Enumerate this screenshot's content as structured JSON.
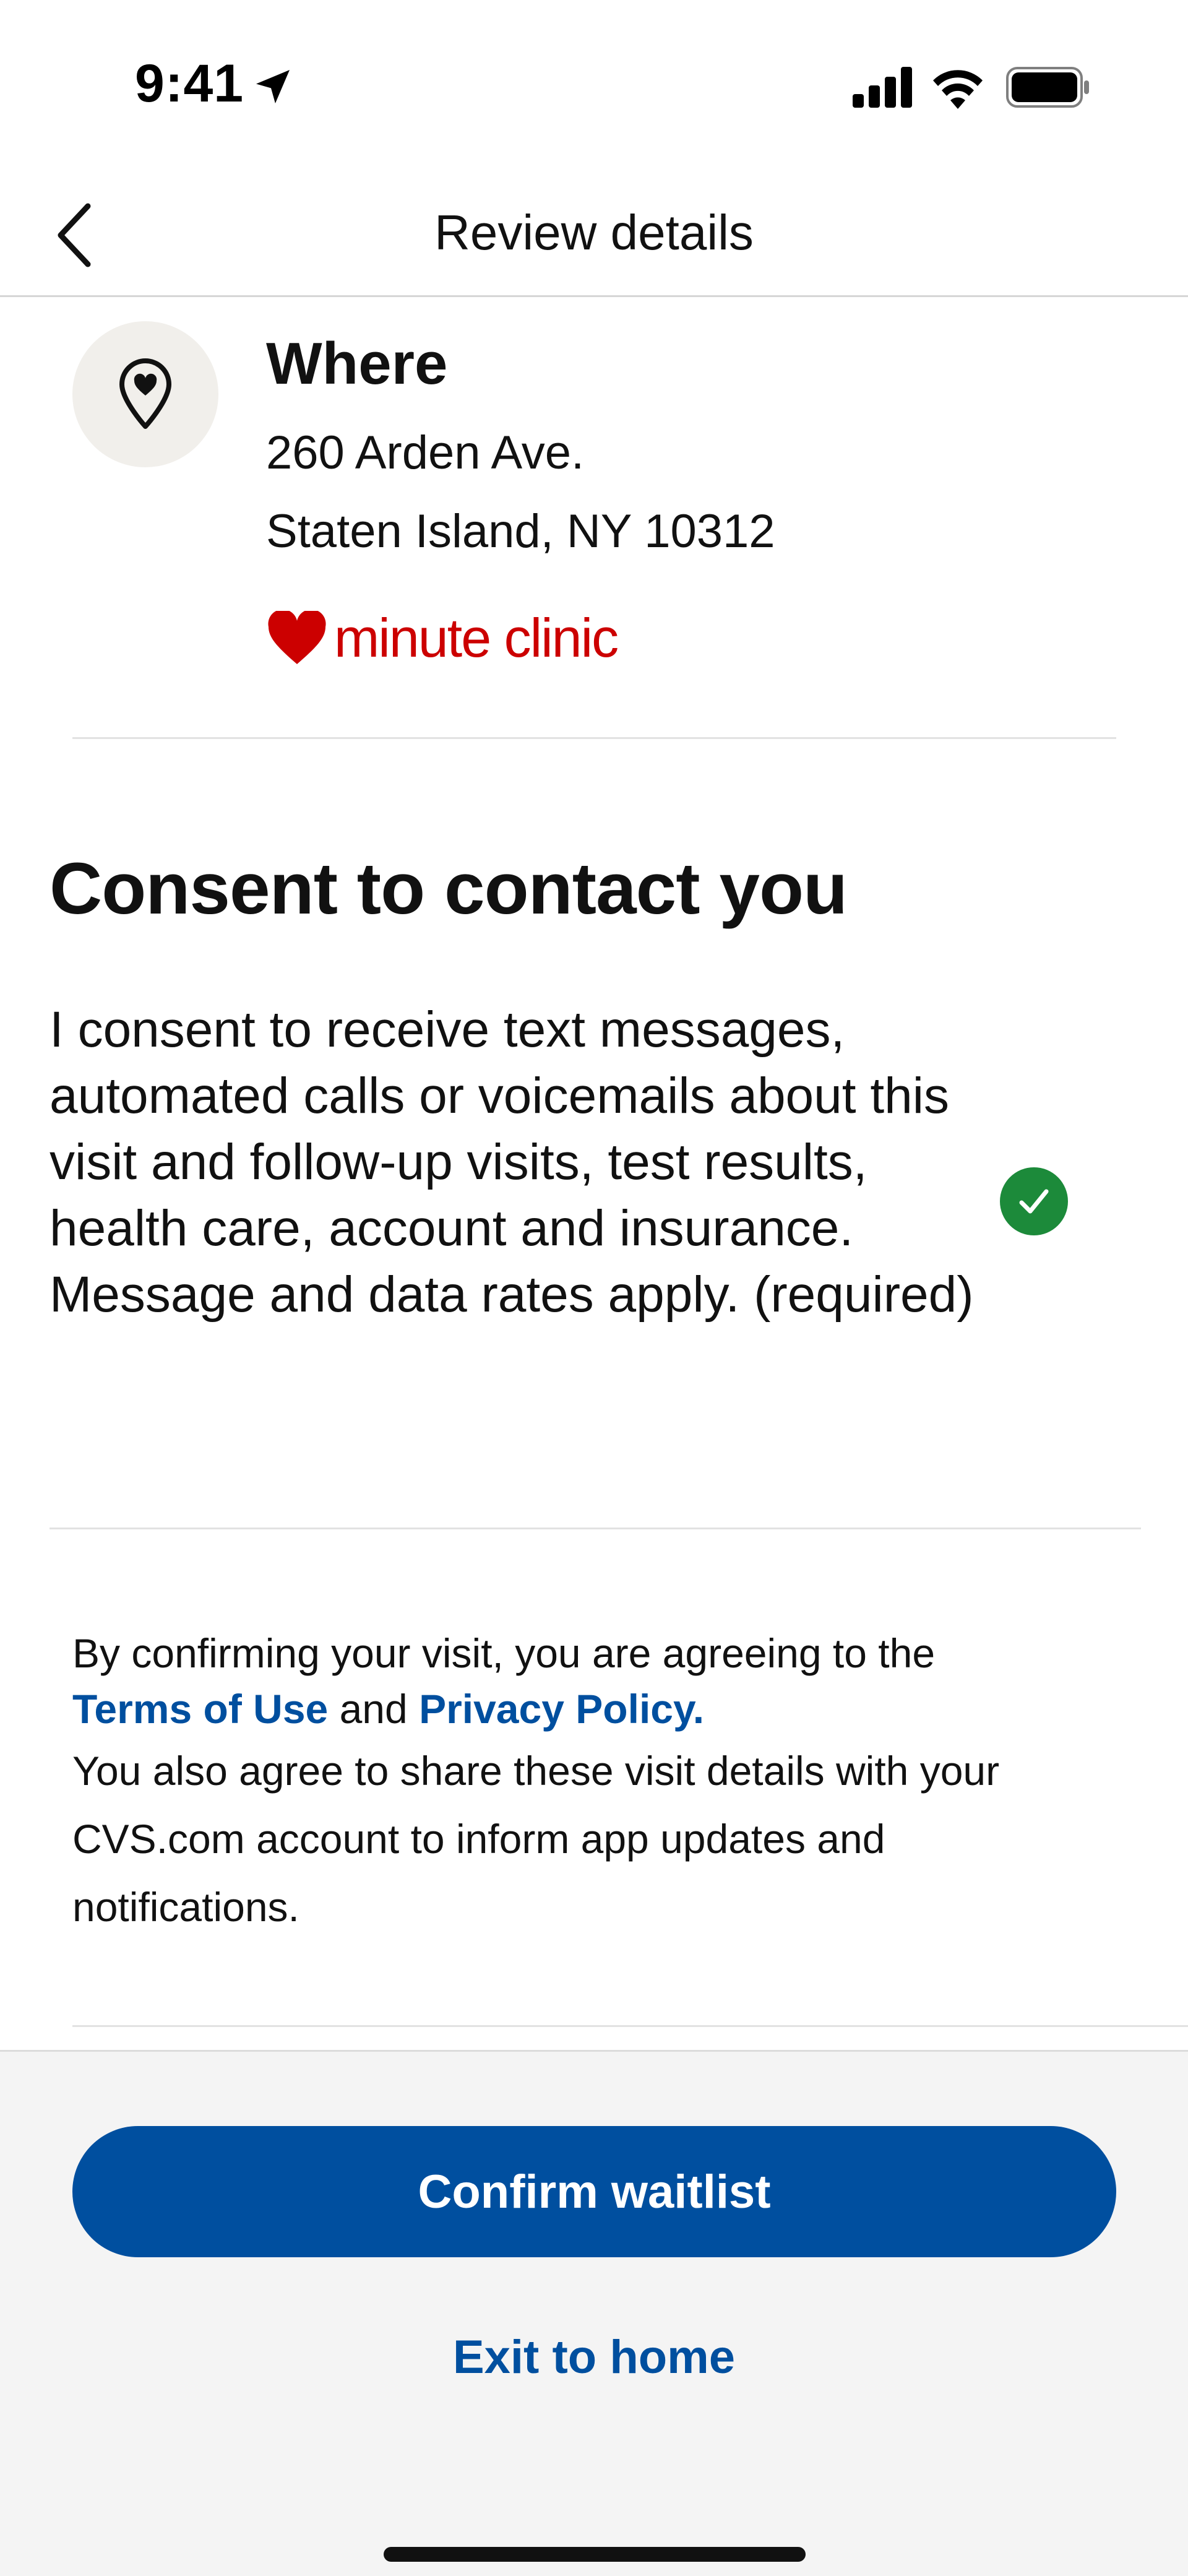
{
  "status_bar": {
    "time": "9:41",
    "icons": [
      "location-arrow-icon",
      "cellular-signal-icon",
      "wifi-icon",
      "battery-icon"
    ]
  },
  "nav": {
    "title": "Review details",
    "back_icon": "chevron-left-icon"
  },
  "where": {
    "icon": "location-pin-heart-icon",
    "title": "Where",
    "address_line1": "260 Arden Ave.",
    "address_line2": "Staten Island, NY 10312",
    "brand": "minute clinic",
    "brand_color": "#cc0000"
  },
  "consent": {
    "title": "Consent to contact you",
    "text": "I consent to receive text messages, automated calls or voicemails about this visit and follow-up visits, test results, health care, account and insurance. Message and data rates apply. (required)",
    "checked": true,
    "check_color": "#1c8a3a"
  },
  "legal": {
    "intro": "By confirming your visit, you are agreeing to the",
    "terms_link": "Terms of Use",
    "conjunction": "and",
    "privacy_link": "Privacy Policy.",
    "share_text": "You also agree to share these visit details with your CVS.com account to inform app updates and notifications."
  },
  "actions": {
    "confirm_label": "Confirm waitlist",
    "exit_label": "Exit to home",
    "primary_color": "#004f9f"
  }
}
